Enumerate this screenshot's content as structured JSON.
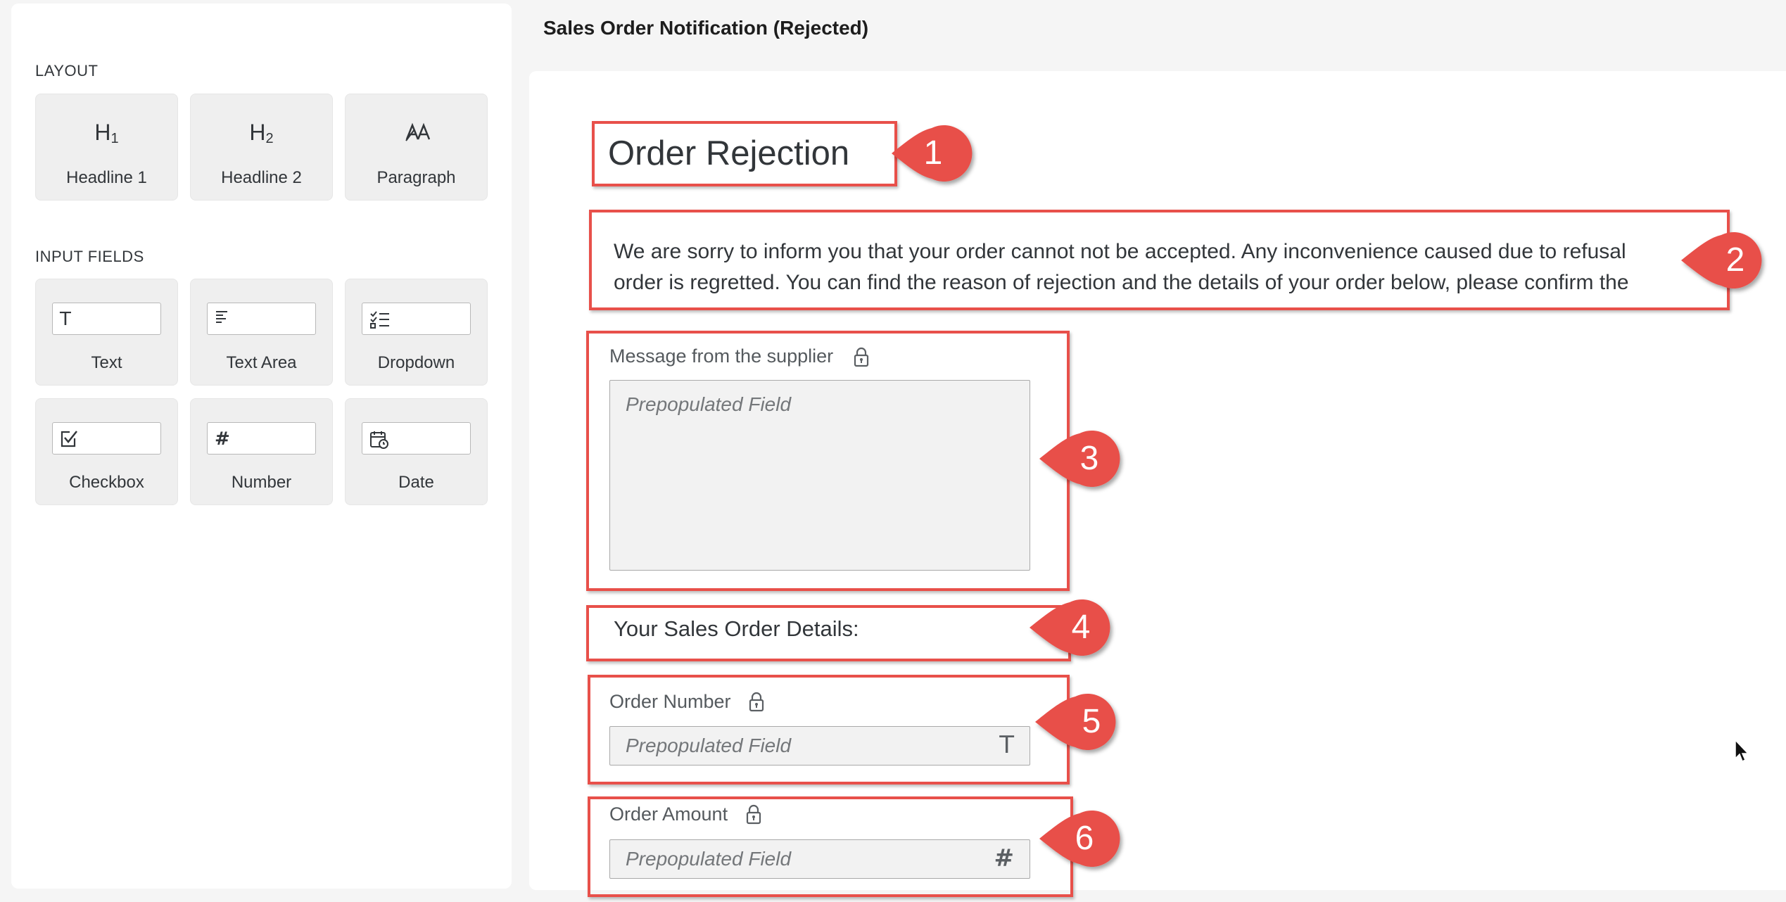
{
  "sidebar": {
    "layout_label": "LAYOUT",
    "input_fields_label": "INPUT FIELDS",
    "layout_items": [
      {
        "label": "Headline 1",
        "glyph": "H",
        "sub": "1"
      },
      {
        "label": "Headline 2",
        "glyph": "H",
        "sub": "2"
      },
      {
        "label": "Paragraph",
        "icon": "paragraph-icon"
      }
    ],
    "input_items": [
      {
        "label": "Text",
        "icon": "text-icon",
        "glyph": "T"
      },
      {
        "label": "Text Area",
        "icon": "text-area-icon"
      },
      {
        "label": "Dropdown",
        "icon": "dropdown-list-icon"
      },
      {
        "label": "Checkbox",
        "icon": "checkbox-icon"
      },
      {
        "label": "Number",
        "icon": "number-icon",
        "glyph": "#"
      },
      {
        "label": "Date",
        "icon": "calendar-icon"
      }
    ]
  },
  "header": {
    "title": "Sales Order Notification (Rejected)"
  },
  "form": {
    "headline": "Order Rejection",
    "paragraph_line1": "We are sorry to inform you that your order cannot not be accepted. Any inconvenience caused due to refusal",
    "paragraph_line2": "order is regretted. You can find the reason of rejection and the details of your order below, please confirm the",
    "message_label": "Message from the supplier",
    "message_placeholder": "Prepopulated Field",
    "details_heading": "Your Sales Order Details:",
    "order_number_label": "Order Number",
    "order_number_placeholder": "Prepopulated Field",
    "order_number_icon": "T",
    "order_amount_label": "Order Amount",
    "order_amount_placeholder": "Prepopulated Field",
    "order_amount_icon": "#"
  },
  "callouts": [
    "1",
    "2",
    "3",
    "4",
    "5",
    "6"
  ],
  "colors": {
    "accent_red": "#e8504a",
    "canvas_bg": "#ffffff",
    "page_bg": "#f5f5f5",
    "tile_bg": "#efefef"
  }
}
